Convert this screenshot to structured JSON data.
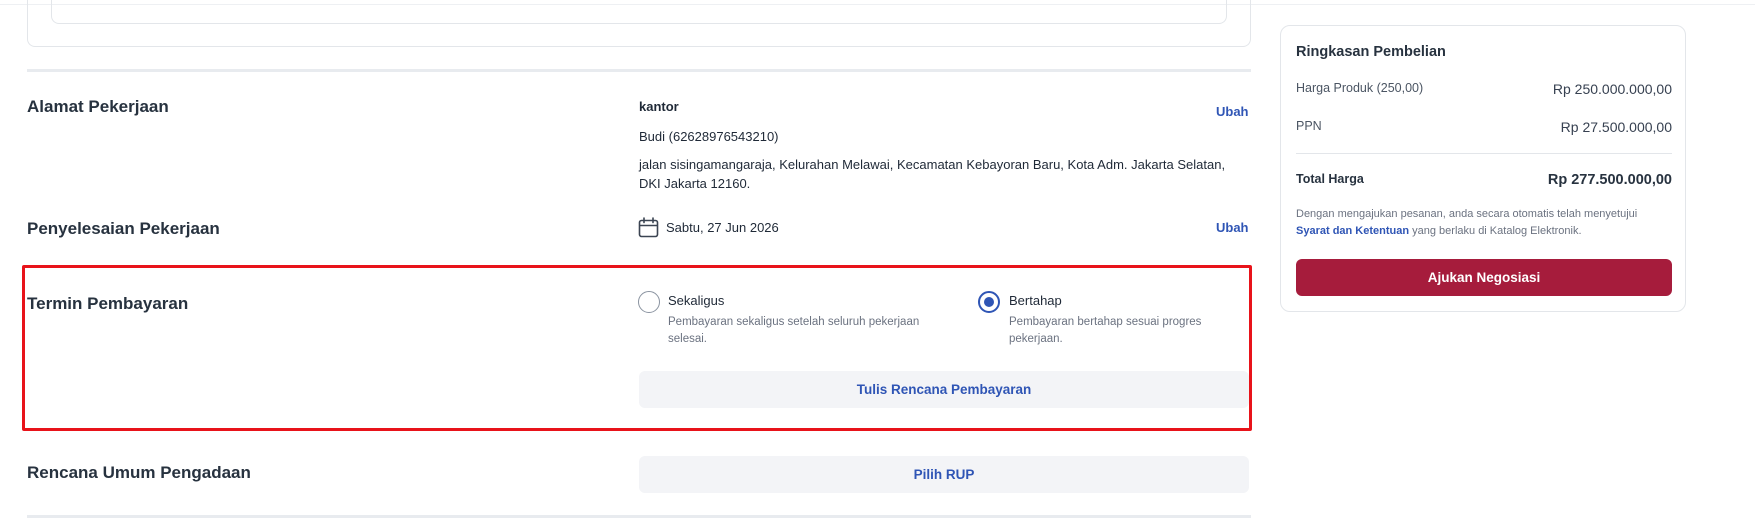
{
  "address": {
    "title": "Alamat Pekerjaan",
    "label": "kantor",
    "contact": "Budi (62628976543210)",
    "line1": "jalan sisingamangaraja, Kelurahan Melawai, Kecamatan Kebayoran Baru, Kota Adm. Jakarta Selatan,",
    "line2": "DKI Jakarta 12160.",
    "edit_label": "Ubah"
  },
  "completion": {
    "title": "Penyelesaian Pekerjaan",
    "date": "Sabtu, 27 Jun 2026",
    "edit_label": "Ubah",
    "icon": "calendar-icon"
  },
  "payment_term": {
    "title": "Termin Pembayaran",
    "options": [
      {
        "label": "Sekaligus",
        "desc_line1": "Pembayaran sekaligus setelah seluruh pekerjaan",
        "desc_line2": "selesai.",
        "selected": false
      },
      {
        "label": "Bertahap",
        "desc_line1": "Pembayaran bertahap sesuai progres",
        "desc_line2": "pekerjaan.",
        "selected": true
      }
    ],
    "plan_button": "Tulis Rencana Pembayaran"
  },
  "procurement_plan": {
    "title": "Rencana Umum Pengadaan",
    "button": "Pilih RUP"
  },
  "summary": {
    "title": "Ringkasan Pembelian",
    "product_label": "Harga Produk (250,00)",
    "product_value": "Rp 250.000.000,00",
    "tax_label": "PPN",
    "tax_value": "Rp 27.500.000,00",
    "total_label": "Total Harga",
    "total_value": "Rp 277.500.000,00",
    "terms_pre": "Dengan mengajukan pesanan, anda secara otomatis telah menyetujui",
    "terms_link": "Syarat dan Ketentuan",
    "terms_post": " yang berlaku di Katalog Elektronik.",
    "submit_label": "Ajukan Negosiasi"
  },
  "colors": {
    "accent": "#2f55b5",
    "primary_button": "#a61c3c",
    "highlight": "#e8131a"
  }
}
